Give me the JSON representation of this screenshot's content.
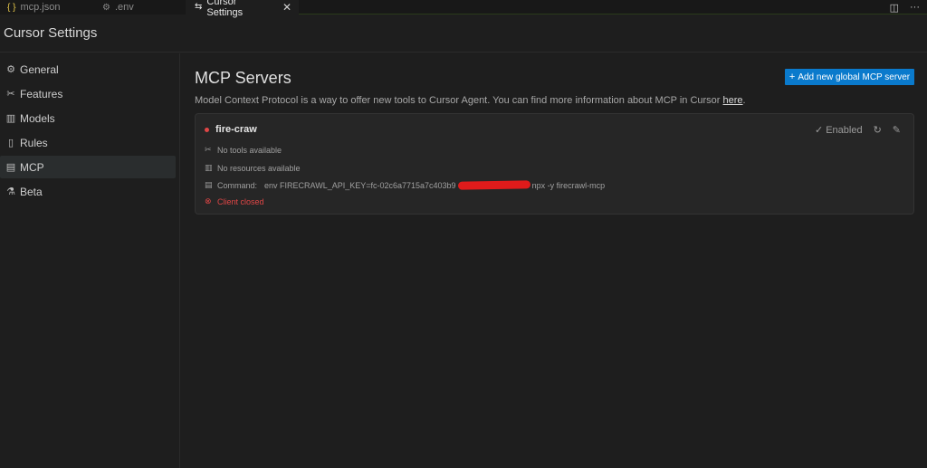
{
  "tabs": [
    {
      "label": "mcp.json",
      "icon": "{ }",
      "icon_name": "json-braces-icon"
    },
    {
      "label": ".env",
      "icon": "⚙",
      "icon_name": "gear-icon"
    },
    {
      "label": "Cursor Settings",
      "icon": "⇆",
      "icon_name": "settings-sliders-icon",
      "active": true
    }
  ],
  "header": {
    "title": "Cursor Settings"
  },
  "sidebar": {
    "items": [
      {
        "label": "General",
        "icon": "gear-icon"
      },
      {
        "label": "Features",
        "icon": "tools-icon"
      },
      {
        "label": "Models",
        "icon": "bar-chart-icon"
      },
      {
        "label": "Rules",
        "icon": "document-icon"
      },
      {
        "label": "MCP",
        "icon": "server-icon",
        "active": true
      },
      {
        "label": "Beta",
        "icon": "flask-icon"
      }
    ]
  },
  "main": {
    "title": "MCP Servers",
    "add_button": "Add new global MCP server",
    "description": "Model Context Protocol is a way to offer new tools to Cursor Agent. You can find more information about MCP in Cursor ",
    "description_link": "here",
    "description_end": ".",
    "server": {
      "name": "fire-craw",
      "enabled_label": "Enabled",
      "tools": "No tools available",
      "resources": "No resources available",
      "command_label": "Command:",
      "command_before": "env FIRECRAWL_API_KEY=fc-02c6a7715a7c403b9",
      "command_after": "npx -y firecrawl-mcp",
      "error": "Client closed"
    }
  },
  "colors": {
    "accent": "#0a7acc",
    "error": "#e04646",
    "background": "#1e1e1e",
    "card": "#262626"
  }
}
